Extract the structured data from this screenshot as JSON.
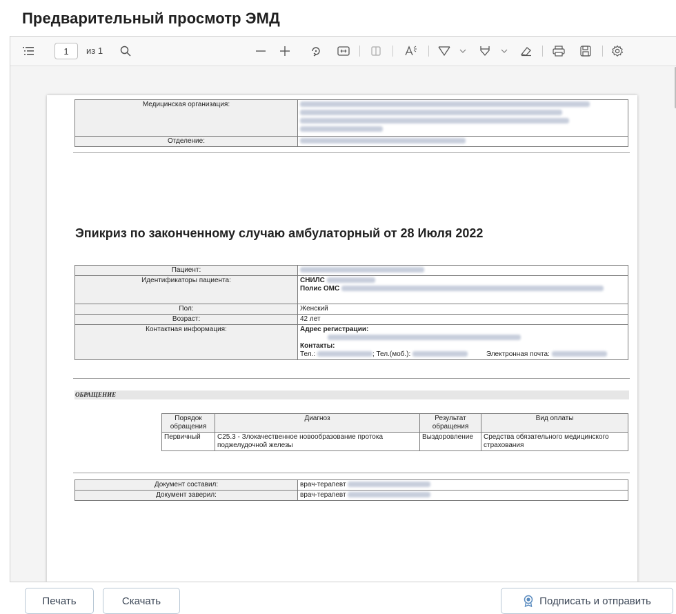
{
  "page_title": "Предварительный просмотр ЭМД",
  "toolbar": {
    "page_current": "1",
    "page_of": "из 1",
    "icons": [
      "list-icon",
      "search-icon",
      "zoom-out-icon",
      "zoom-in-icon",
      "rotate-icon",
      "fit-width-icon",
      "page-view-icon",
      "read-aloud-icon",
      "draw-icon",
      "highlight-icon",
      "eraser-icon",
      "print-icon",
      "save-icon",
      "settings-icon"
    ]
  },
  "document": {
    "org_label": "Медицинская организация:",
    "dept_label": "Отделение:",
    "heading": "Эпикриз по законченному случаю амбулаторный от 28 Июля 2022",
    "patient": {
      "patient_label": "Пациент:",
      "ids_label": "Идентификаторы пациента:",
      "snils_label": "СНИЛС",
      "polis_label": "Полис ОМС",
      "sex_label": "Пол:",
      "sex_value": "Женский",
      "age_label": "Возраст:",
      "age_value": "42 лет",
      "contact_label": "Контактная информация:",
      "address_label": "Адрес регистрации:",
      "contacts_label": "Контакты:",
      "phone_label": "Тел.:",
      "mobile_label": "; Тел.(моб.):",
      "email_label": "Электронная почта:"
    },
    "section_title": "ОБРАЩЕНИЕ",
    "visit_table": {
      "headers": [
        "Порядок обращения",
        "Диагноз",
        "Результат обращения",
        "Вид оплаты"
      ],
      "rows": [
        [
          "Первичный",
          "С25.3 - Злокачественное новообразование протока поджелудочной железы",
          "Выздоровление",
          "Средства обязательного медицинского страхования"
        ]
      ]
    },
    "signatures": {
      "composed_label": "Документ составил:",
      "composed_value": "врач-терапевт",
      "certified_label": "Документ заверил:",
      "certified_value": "врач-терапевт"
    }
  },
  "buttons": {
    "print": "Печать",
    "download": "Скачать",
    "sign_send": "Подписать и отправить"
  },
  "colors": {
    "accent": "#5a8bbf",
    "button_border": "#b7c6d4"
  }
}
